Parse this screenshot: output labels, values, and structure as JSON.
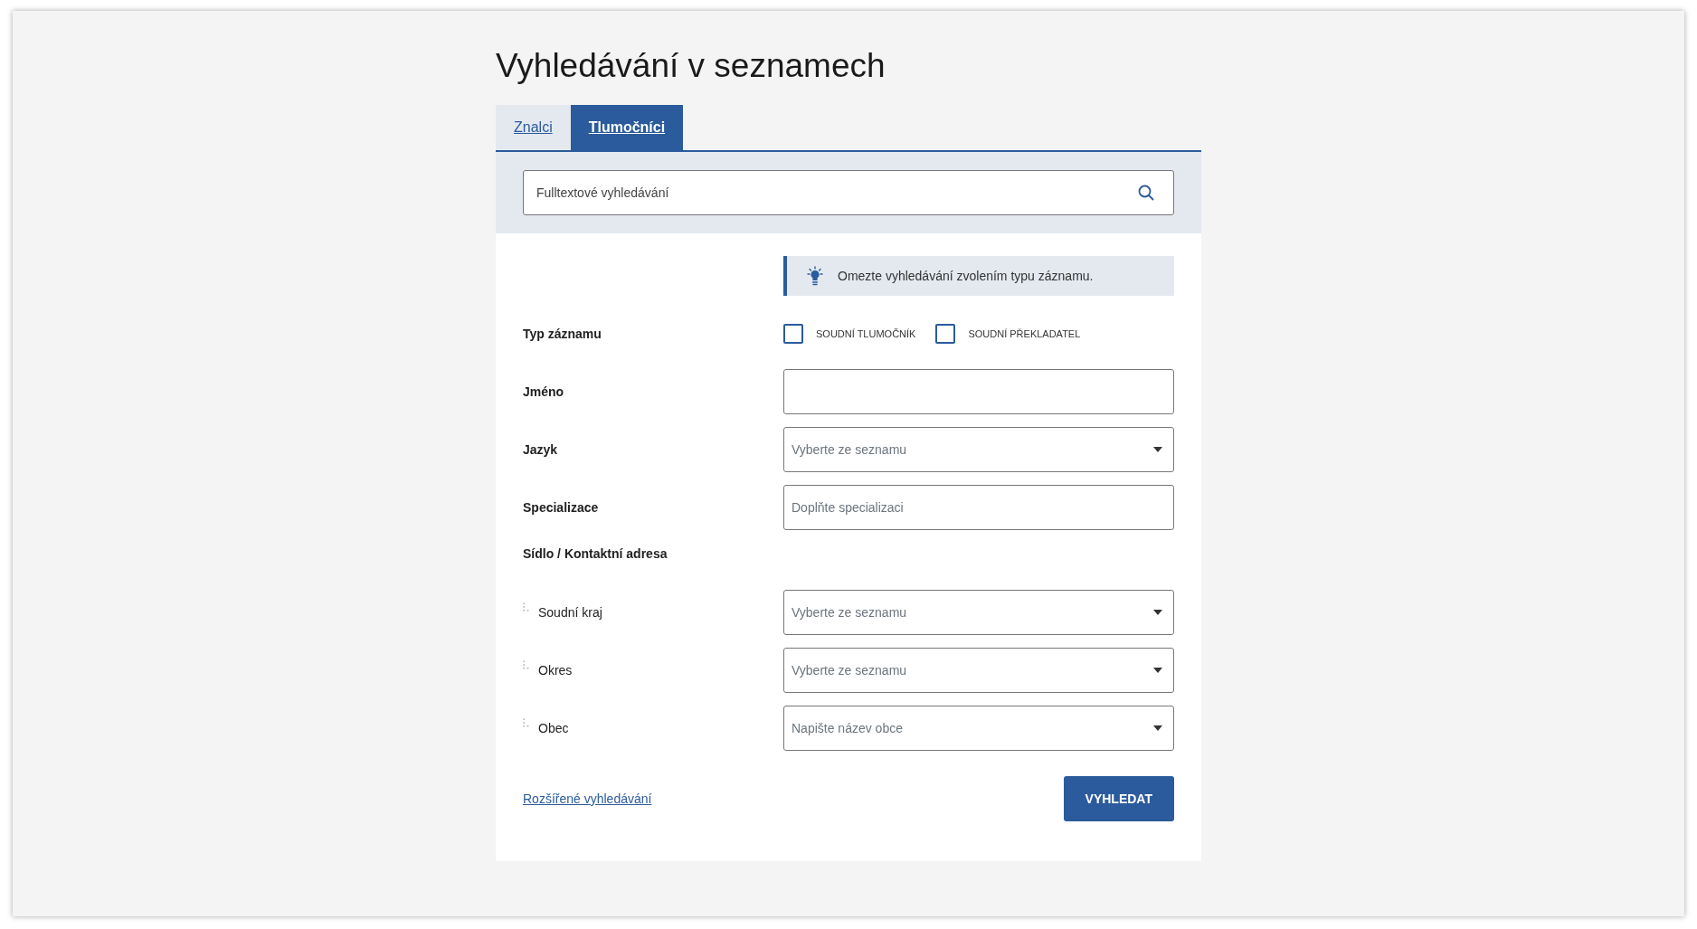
{
  "title": "Vyhledávání v seznamech",
  "tabs": [
    {
      "label": "Znalci",
      "selected": false
    },
    {
      "label": "Tlumočníci",
      "selected": true
    }
  ],
  "search": {
    "placeholder": "Fulltextové vyhledávání"
  },
  "hint": "Omezte vyhledávání zvolením typu záznamu.",
  "form": [
    {
      "kind": "checkboxes",
      "label": "Typ záznamu",
      "options": [
        {
          "label": "SOUDNÍ TLUMOČNÍK",
          "checked": false
        },
        {
          "label": "SOUDNÍ PŘEKLADATEL",
          "checked": false
        }
      ]
    },
    {
      "kind": "text",
      "label": "Jméno"
    },
    {
      "kind": "select",
      "label": "Jazyk",
      "placeholder": "Vyberte ze seznamu"
    },
    {
      "kind": "text",
      "label": "Specializace",
      "placeholder": "Doplňte specializaci"
    },
    {
      "kind": "group",
      "label": "Sídlo / Kontaktní adresa",
      "children": [
        {
          "kind": "select",
          "label": "Soudní kraj",
          "placeholder": "Vyberte ze seznamu"
        },
        {
          "kind": "select",
          "label": "Okres",
          "placeholder": "Vyberte ze seznamu"
        },
        {
          "kind": "select",
          "label": "Obec",
          "placeholder": "Napište název obce"
        }
      ]
    }
  ],
  "advanced_link": "Rozšířené vyhledávání",
  "submit": "VYHLEDAT"
}
